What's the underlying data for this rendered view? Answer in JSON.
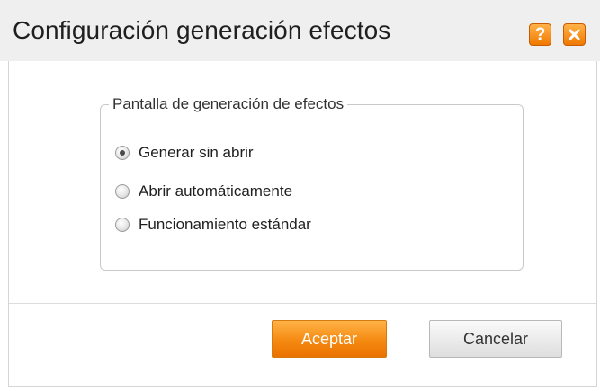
{
  "window": {
    "title": "Configuración generación efectos",
    "help_label": "?",
    "close_icon": "close-icon"
  },
  "group": {
    "legend": "Pantalla de generación de efectos",
    "options": [
      {
        "label": "Generar sin abrir",
        "checked": true
      },
      {
        "label": "Abrir automáticamente",
        "checked": false
      },
      {
        "label": "Funcionamiento estándar",
        "checked": false
      }
    ]
  },
  "buttons": {
    "ok_label": "Aceptar",
    "cancel_label": "Cancelar"
  },
  "colors": {
    "accent": "#f58a11",
    "title_bar": "#efefef"
  }
}
